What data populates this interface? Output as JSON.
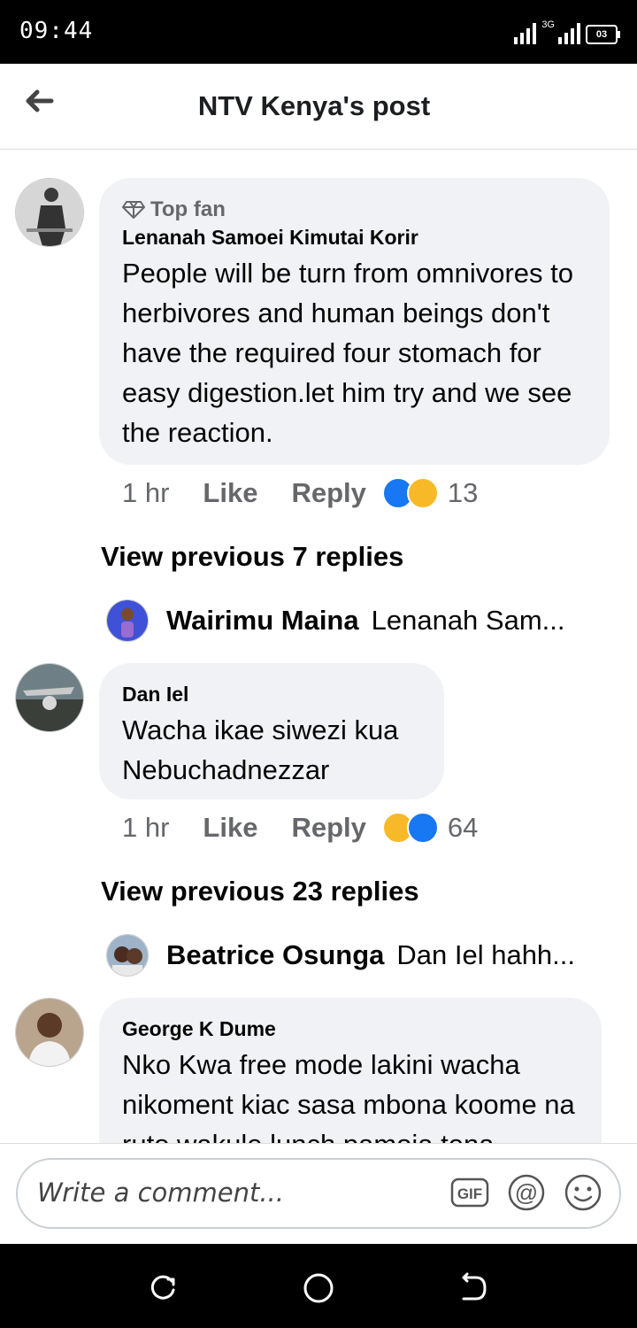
{
  "status_bar": {
    "time": "09:44",
    "network": "3G",
    "battery": "03"
  },
  "header": {
    "title": "NTV Kenya's post"
  },
  "comments": [
    {
      "badge": "Top fan",
      "author": "Lenanah Samoei Kimutai Korir",
      "text": "People will be turn from omnivores to herbivores and human beings don't have the required four stomach for easy digestion.let him try and we see the reaction.",
      "time": "1 hr",
      "like_label": "Like",
      "reply_label": "Reply",
      "reaction_count": "13",
      "view_previous": "View previous 7 replies",
      "reply_preview": {
        "name": "Wairimu Maina",
        "text": "Lenanah Sam..."
      }
    },
    {
      "author": "Dan Iel",
      "text": "Wacha ikae siwezi kua Nebuchadnezzar",
      "time": "1 hr",
      "like_label": "Like",
      "reply_label": "Reply",
      "reaction_count": "64",
      "view_previous": "View previous 23 replies",
      "reply_preview": {
        "name": "Beatrice Osunga",
        "text": "Dan Iel hahh..."
      }
    },
    {
      "author": "George K Dume",
      "text": "Nko Kwa free mode lakini wacha nikoment kiac sasa mbona koome na ruto wakule lunch pamoja tena"
    }
  ],
  "composer": {
    "placeholder": "Write a comment...",
    "gif_label": "GIF",
    "at_label": "@"
  }
}
